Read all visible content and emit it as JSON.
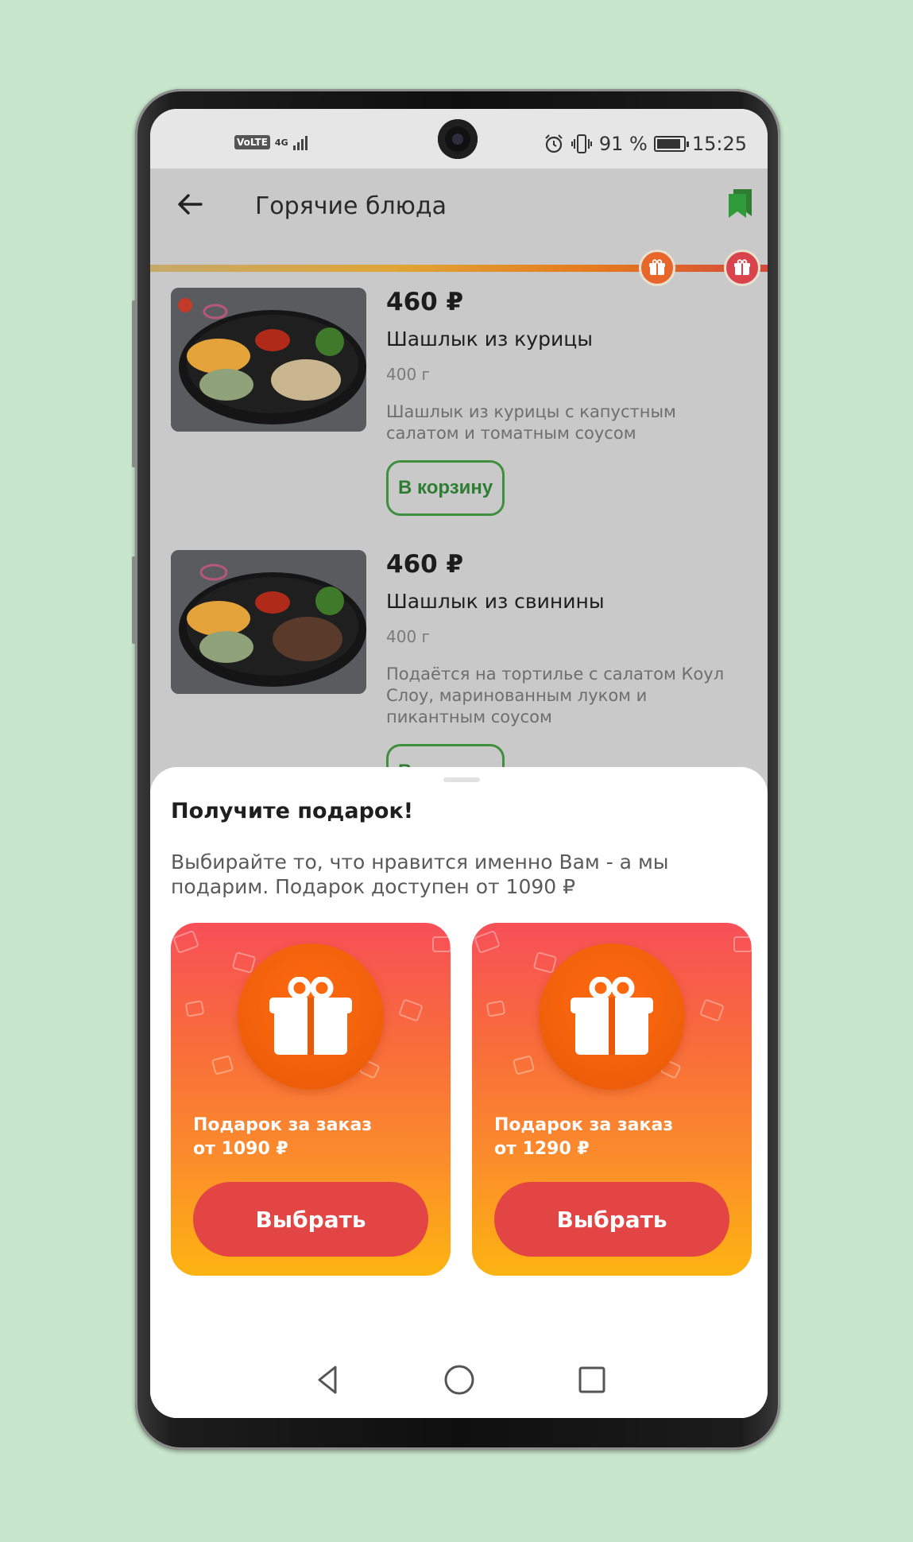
{
  "status_bar": {
    "volte": "VoLTE",
    "network": "4G",
    "battery_percent": "91 %",
    "time": "15:25"
  },
  "app_bar": {
    "title": "Горячие блюда"
  },
  "gift_progress": {
    "markers": [
      "gift-icon",
      "gift-icon"
    ]
  },
  "products": [
    {
      "price": "460 ₽",
      "name": "Шашлык из курицы",
      "weight": "400 г",
      "description": "Шашлык из курицы с капустным салатом и томатным соусом",
      "cart_label": "В корзину"
    },
    {
      "price": "460 ₽",
      "name": "Шашлык из свинины",
      "weight": "400 г",
      "description": "Подаётся на тортилье с салатом Коул Слоу, маринованным луком и пикантным соусом",
      "cart_label": "В корзину"
    }
  ],
  "sheet": {
    "title": "Получите подарок!",
    "subtitle": "Выбирайте то, что нравится именно Вам - а мы подарим. Подарок доступен от 1090 ₽",
    "cards": [
      {
        "label_line1": "Подарок за заказ",
        "label_line2": "от 1090 ₽",
        "button": "Выбрать"
      },
      {
        "label_line1": "Подарок за заказ",
        "label_line2": "от 1290 ₽",
        "button": "Выбрать"
      }
    ]
  },
  "colors": {
    "accent_green": "#2e7d32",
    "gift_red": "#e34444",
    "gift_orange": "#f86d3a",
    "gift_yellow": "#fdb412"
  }
}
